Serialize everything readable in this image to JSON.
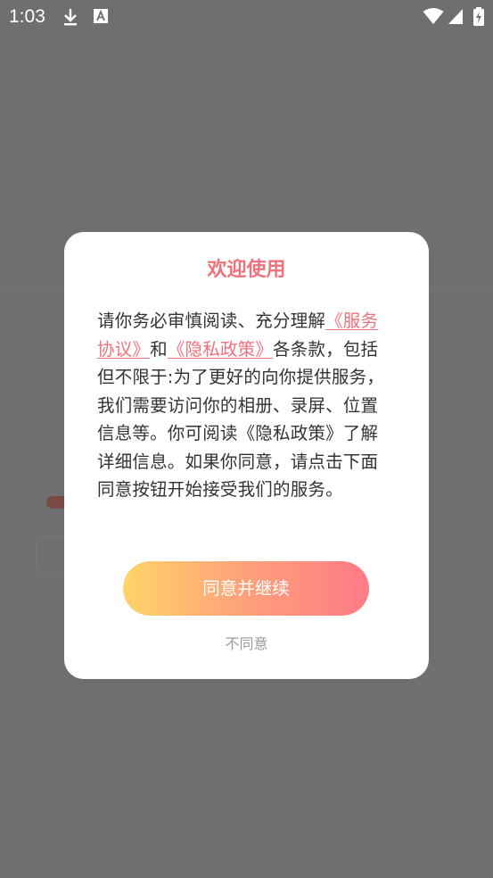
{
  "status_bar": {
    "time": "1:03",
    "icons": [
      "download-icon",
      "font-a-icon",
      "wifi-icon",
      "cellular-signal-icon",
      "battery-charging-icon"
    ]
  },
  "dialog": {
    "title": "欢迎使用",
    "body": {
      "prefix": "请你务必审慎阅读、充分理解",
      "link_service": "《服务协议》",
      "middle": "和",
      "link_privacy": "《隐私政策》",
      "suffix": "各条款，包括但不限于:为了更好的向你提供服务，我们需要访问你的相册、录屏、位置信息等。你可阅读《隐私政策》了解详细信息。如果你同意，请点击下面同意按钮开始接受我们的服务。"
    },
    "agree_label": "同意并继续",
    "disagree_label": "不同意"
  },
  "colors": {
    "accent": "#f0717c",
    "scrim": "#6f6f6f",
    "button_gradient_start": "#ffd46a",
    "button_gradient_end": "#ff7a86"
  }
}
